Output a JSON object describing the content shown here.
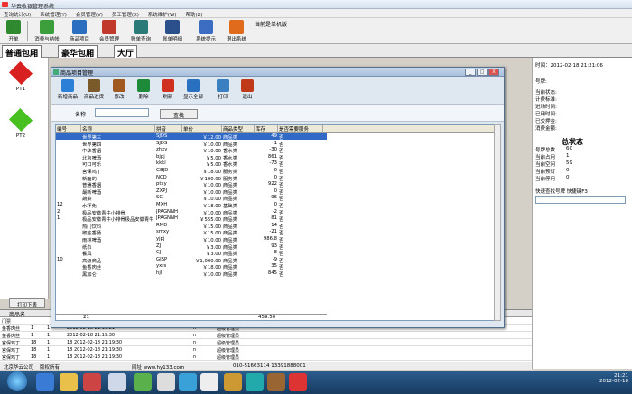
{
  "window": {
    "title": "华云收银管理系统"
  },
  "menu": [
    "查询统计(U)",
    "系统管理(Y)",
    "会员管理(V)",
    "员工管理(X)",
    "系统维护(W)",
    "帮助(Z)"
  ],
  "toolbar": [
    "开单",
    "消费与结帐",
    "商品项目",
    "会员管理",
    "账单查询",
    "账单明细",
    "系统提示",
    "退出系统"
  ],
  "toolbar_colors": [
    "#2f8a2f",
    "#3b9e3b",
    "#2a6fbf",
    "#c0392b",
    "#2b7a78",
    "#2b4f8a",
    "#3a6cc2",
    "#e06b1a"
  ],
  "current_machine": "当前是单机版",
  "tabs": [
    "普通包厢",
    "豪华包厢",
    "大厅"
  ],
  "rooms": [
    {
      "label": "PT1",
      "color": "#d82020"
    },
    {
      "label": "PT2",
      "color": "#48c020"
    }
  ],
  "dialog": {
    "title": "商品项目管理",
    "buttons": [
      "新增商品",
      "商品进货",
      "修改",
      "删除",
      "刷新",
      "显示全部",
      "打印",
      "退出"
    ],
    "button_colors": [
      "#2c7fd6",
      "#7a5a2a",
      "#a05a20",
      "#1d8a3a",
      "#d03020",
      "#2a70c0",
      "#3a80c0",
      "#c03a1a"
    ],
    "search_label": "名称",
    "search_value": "",
    "search_button": "查找",
    "columns": [
      "编号",
      "名称",
      "拼音",
      "单价",
      "商品类型",
      "库存",
      "是否需要服务"
    ],
    "rows": [
      [
        "",
        "世界第三",
        "SJDS",
        "￥12.00",
        "商品类",
        "49",
        "否"
      ],
      [
        "",
        "世界第四",
        "SJDS",
        "￥10.00",
        "商品类",
        "1",
        "否"
      ],
      [
        "",
        "中华香烟",
        "zhxy",
        "￥10.00",
        "香水类",
        "-30",
        "否"
      ],
      [
        "",
        "北京啤酒",
        "bjpj",
        "￥5.00",
        "香水类",
        "861",
        "否"
      ],
      [
        "",
        "可口可乐",
        "kkkl",
        "￥5.00",
        "香水类",
        "-73",
        "否"
      ],
      [
        "",
        "宫保鸡丁",
        "GBJD",
        "￥18.00",
        "服务类",
        "0",
        "否"
      ],
      [
        "",
        "新面的",
        "NCD",
        "￥100.00",
        "服务类",
        "0",
        "否"
      ],
      [
        "",
        "普通香烟",
        "ptxy",
        "￥10.00",
        "商品类",
        "922",
        "否"
      ],
      [
        "",
        "最新啤酒",
        "ZXPJ",
        "￥10.00",
        "商品类",
        "0",
        "否"
      ],
      [
        "",
        "蔬菜",
        "SC",
        "￥10.00",
        "商品类",
        "96",
        "否"
      ],
      [
        "12",
        "水杯免",
        "MXH",
        "￥18.00",
        "基础类",
        "0",
        "否"
      ],
      [
        "2",
        "极品安徽青牛小排骨",
        "JPAGNNH",
        "￥10.00",
        "商品类",
        "-2",
        "否"
      ],
      [
        "1",
        "极品安徽青牛小排骨极品安徽青牛",
        "JPAGNNH",
        "￥555.00",
        "商品类",
        "81",
        "否"
      ],
      [
        "",
        "热门饮料",
        "RMD",
        "￥15.00",
        "商品类",
        "14",
        "否"
      ],
      [
        "",
        "椒盐香肠",
        "smxy",
        "￥15.00",
        "商品类",
        "-21",
        "否"
      ],
      [
        "",
        "雨林啤酒",
        "yjpj",
        "￥10.00",
        "商品类",
        "986.8",
        "否"
      ],
      [
        "",
        "纸巾",
        "ZJ",
        "￥3.00",
        "商品类",
        "93",
        "否"
      ],
      [
        "",
        "餐具",
        "CJ",
        "￥3.00",
        "商品类",
        "-8",
        "否"
      ],
      [
        "10",
        "高级商品",
        "GJSP",
        "￥1,000.00",
        "商品类",
        "-9",
        "否"
      ],
      [
        "",
        "鱼香肉丝",
        "yxrs",
        "￥18.00",
        "商品类",
        "35",
        "否"
      ],
      [
        "",
        "黑加仑",
        "hjl",
        "￥10.00",
        "商品类",
        "845",
        "否"
      ]
    ],
    "footer_count": "21",
    "footer_total": "459.50",
    "window_buttons": [
      "_",
      "□",
      "X"
    ]
  },
  "right_panel": {
    "time": "时间：2012-02-18 21:21:06",
    "labels": [
      "号牌:",
      "当前状态:",
      "计费标准:",
      "进场时间:",
      "已用时间:",
      "已交押金:",
      "消费金额:"
    ],
    "summary_title": "总状态",
    "summary": [
      [
        "号牌总数",
        "60"
      ],
      [
        "当前占用",
        "1"
      ],
      [
        "当前空闲",
        "59"
      ],
      [
        "当前预订",
        "0"
      ],
      [
        "当前停用",
        "0"
      ]
    ],
    "quick": "快速查找号牌  快捷键F3"
  },
  "print_button": "打印下表",
  "bottom_header": "商品名",
  "bottom_rows": [
    [
      "门票",
      "",
      "",
      "",
      "",
      ""
    ],
    [
      "鱼香肉丝",
      "1",
      "1",
      "2012-02-18 21:19:21",
      "n",
      "超级管理员"
    ],
    [
      "鱼香肉丝",
      "1",
      "1",
      "2012-02-18 21:19:30",
      "n",
      "超级管理员"
    ],
    [
      "宫保鸡丁",
      "18",
      "1",
      "18 2012-02-18 21:19:30",
      "n",
      "超级管理员"
    ],
    [
      "宫保鸡丁",
      "18",
      "1",
      "18 2012-02-18 21:19:30",
      "n",
      "超级管理员"
    ],
    [
      "宫保鸡丁",
      "18",
      "1",
      "18 2012-02-18 21:19:30",
      "n",
      "超级管理员"
    ],
    [
      "宫保鸡丁",
      "18",
      "1",
      "18 2012-02-18 21:19:30",
      "n",
      "超级管理员"
    ]
  ],
  "status": {
    "company": "北京华云公司",
    "rights": "版权所有",
    "site": "网址 www.hy133.com",
    "phone": "010-51663114 13391888001"
  },
  "taskbar": {
    "time": "21:21",
    "date": "2012-02-18"
  }
}
